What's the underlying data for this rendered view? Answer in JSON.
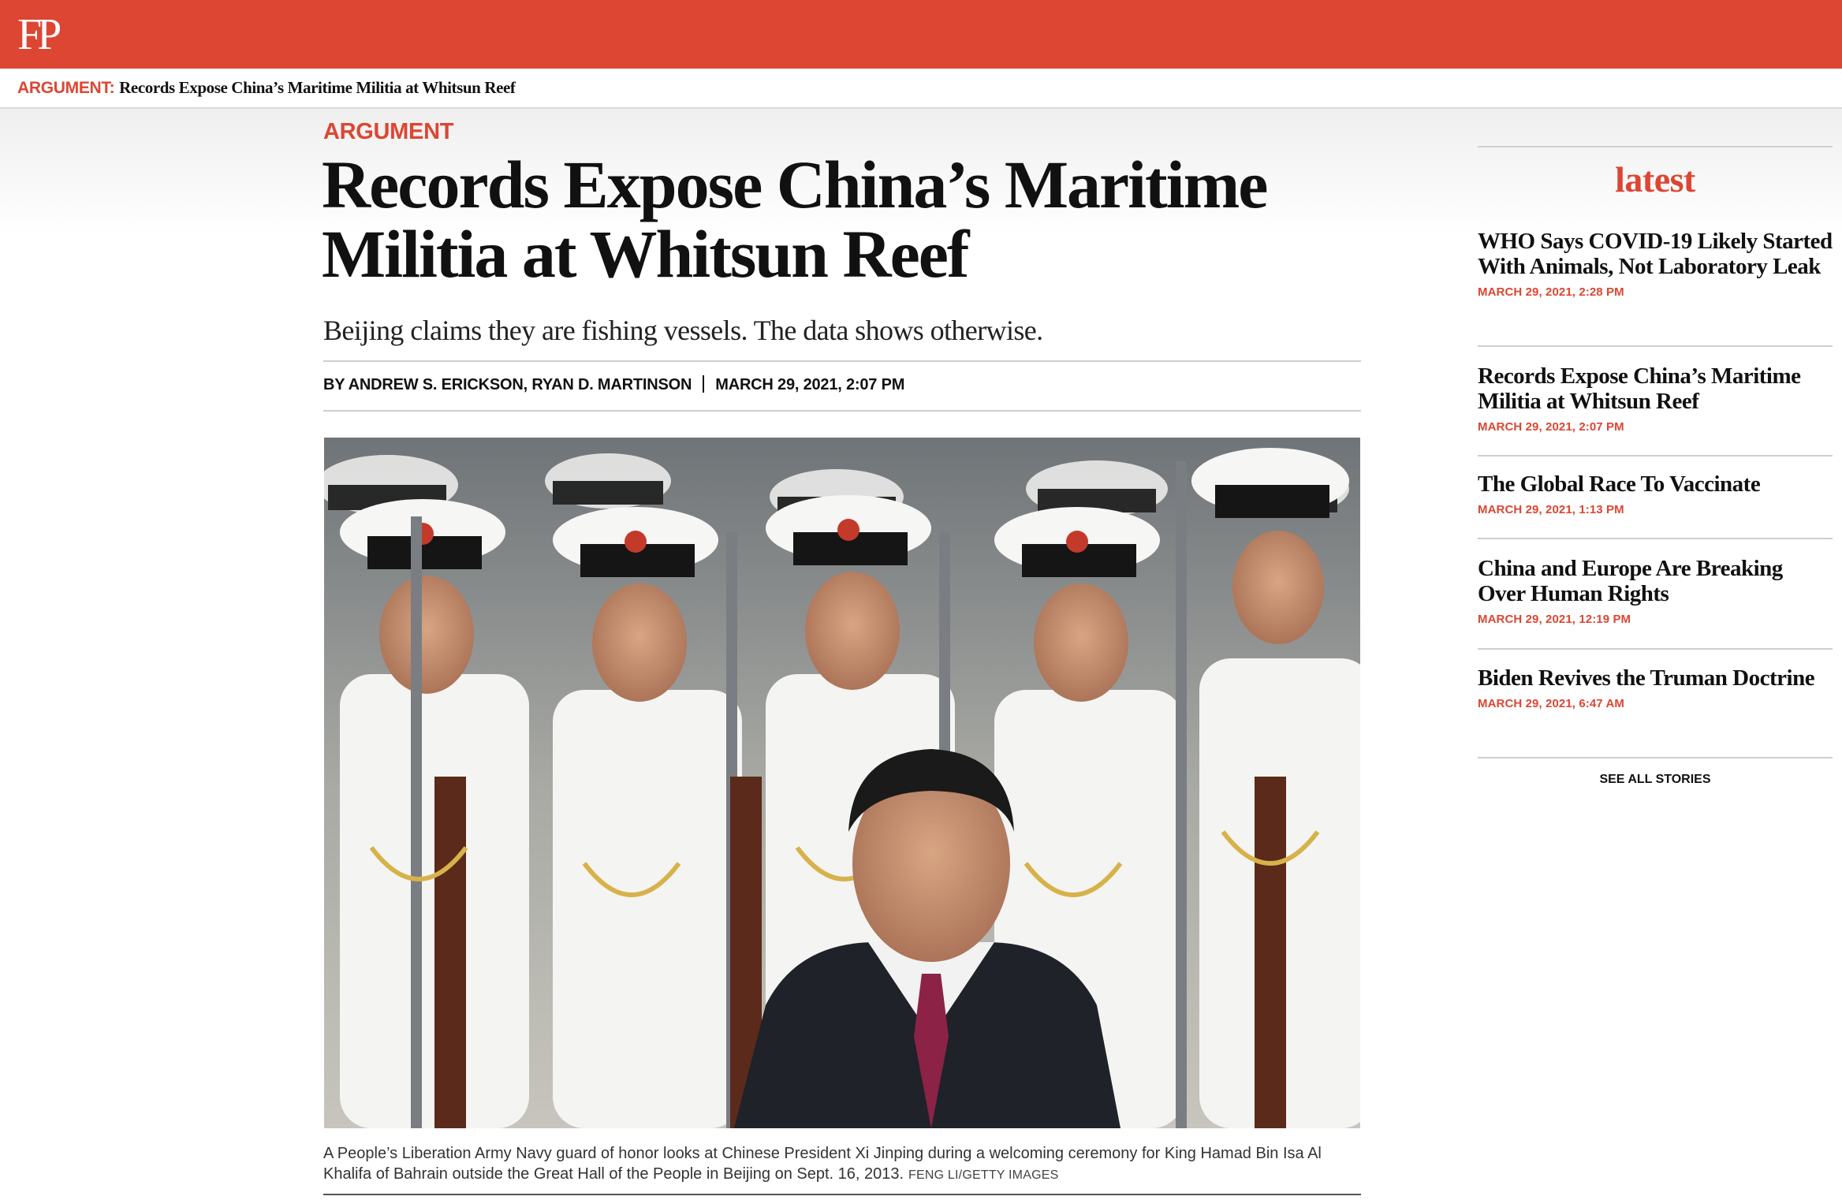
{
  "header": {
    "logo": "FP",
    "brand_color": "#dc4633"
  },
  "breadcrumb": {
    "kicker": "ARGUMENT:",
    "title": "Records Expose China’s Maritime Militia at Whitsun Reef"
  },
  "article": {
    "kicker": "ARGUMENT",
    "headline": "Records Expose China’s Maritime Militia at Whitsun Reef",
    "dek": "Beijing claims they are fishing vessels. The data shows otherwise.",
    "byline": "BY ANDREW S. ERICKSON, RYAN D. MARTINSON",
    "date": "MARCH 29, 2021, 2:07 PM",
    "image": {
      "caption": "A People’s Liberation Army Navy guard of honor looks at Chinese President Xi Jinping during a welcoming ceremony for King Hamad Bin Isa Al Khalifa of Bahrain outside the Great Hall of the People in Beijing on Sept. 16, 2013.",
      "credit": "FENG LI/GETTY IMAGES"
    }
  },
  "sidebar": {
    "heading": "latest",
    "items": [
      {
        "title": "WHO Says COVID-19 Likely Started With Animals, Not Laboratory Leak",
        "date": "MARCH 29, 2021, 2:28 PM"
      },
      {
        "title": "Records Expose China’s Maritime Militia at Whitsun Reef",
        "date": "MARCH 29, 2021, 2:07 PM"
      },
      {
        "title": "The Global Race To Vaccinate",
        "date": "MARCH 29, 2021, 1:13 PM"
      },
      {
        "title": "China and Europe Are Breaking Over Human Rights",
        "date": "MARCH 29, 2021, 12:19 PM"
      },
      {
        "title": "Biden Revives the Truman Doctrine",
        "date": "MARCH 29, 2021, 6:47 AM"
      }
    ],
    "see_all": "SEE ALL STORIES"
  }
}
